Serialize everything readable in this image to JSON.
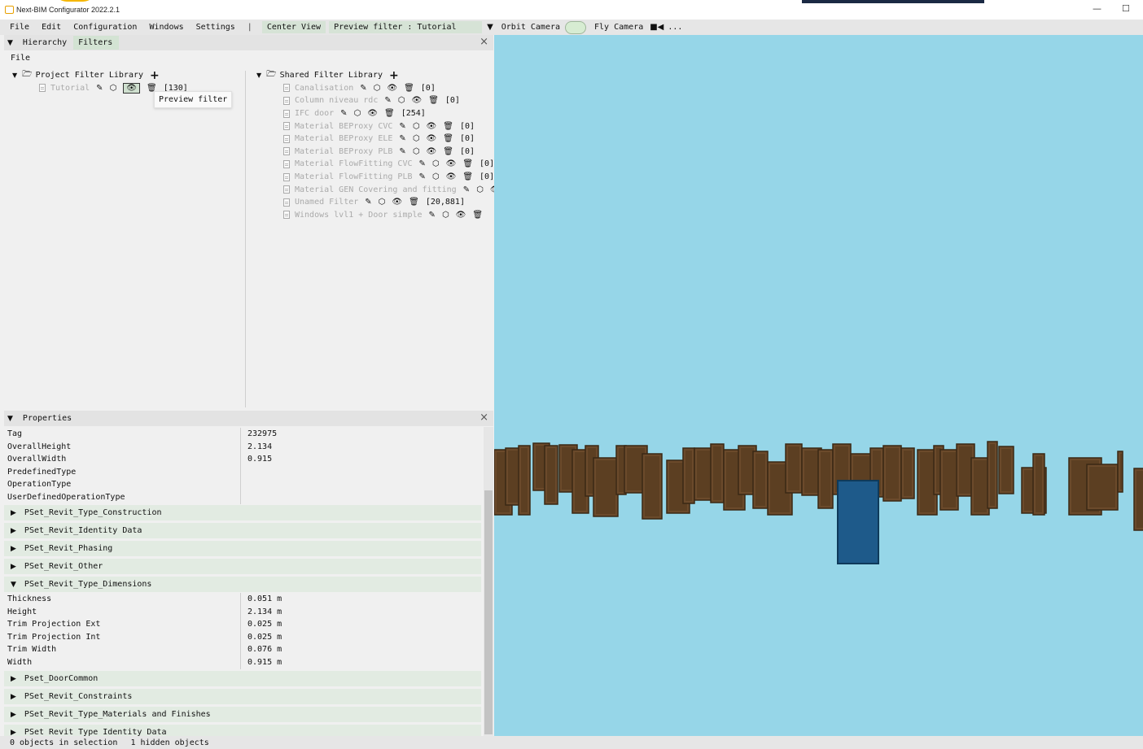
{
  "app": {
    "title": "Next-BIM Configurator 2022.2.1"
  },
  "window_controls": {
    "minimize": "—",
    "maximize": "☐"
  },
  "menubar": {
    "items": [
      "File",
      "Edit",
      "Configuration",
      "Windows",
      "Settings"
    ],
    "separator": "|",
    "center_view": "Center View",
    "preview_filter": "Preview filter : Tutorial",
    "orbit_camera": "Orbit Camera",
    "fly_camera": "Fly Camera",
    "more": "..."
  },
  "left_panel": {
    "tabs": [
      "Hierarchy",
      "Filters"
    ],
    "active_tab": "Filters",
    "file_label": "File",
    "project_library": {
      "title": "Project Filter Library",
      "filters": [
        {
          "name": "Tutorial",
          "count": "[130]"
        }
      ]
    },
    "shared_library": {
      "title": "Shared Filter Library",
      "filters": [
        {
          "name": "Canalisation",
          "count": "[0]"
        },
        {
          "name": "Column niveau rdc",
          "count": "[0]"
        },
        {
          "name": "IFC door",
          "count": "[254]"
        },
        {
          "name": "Material BEProxy CVC",
          "count": "[0]"
        },
        {
          "name": "Material BEProxy ELE",
          "count": "[0]"
        },
        {
          "name": "Material BEProxy PLB",
          "count": "[0]"
        },
        {
          "name": "Material FlowFitting CVC",
          "count": "[0]"
        },
        {
          "name": "Material FlowFitting PLB",
          "count": "[0]"
        },
        {
          "name": "Material GEN Covering and fitting",
          "count": ""
        },
        {
          "name": "Unamed Filter",
          "count": "[20,881]"
        },
        {
          "name": "Windows lvl1 + Door simple",
          "count": ""
        }
      ]
    },
    "tooltip": "Preview filter"
  },
  "properties": {
    "title": "Properties",
    "rows": [
      {
        "key": "Tag",
        "value": "232975"
      },
      {
        "key": "OverallHeight",
        "value": "2.134"
      },
      {
        "key": "OverallWidth",
        "value": "0.915"
      },
      {
        "key": "PredefinedType",
        "value": ""
      },
      {
        "key": "OperationType",
        "value": ""
      },
      {
        "key": "UserDefinedOperationType",
        "value": ""
      }
    ],
    "psets_top": [
      "PSet_Revit_Type_Construction",
      "PSet_Revit_Identity Data",
      "PSet_Revit_Phasing",
      "PSet_Revit_Other"
    ],
    "expanded_pset": "PSet_Revit_Type_Dimensions",
    "dimensions": [
      {
        "key": "Thickness",
        "value": "0.051 m"
      },
      {
        "key": "Height",
        "value": "2.134 m"
      },
      {
        "key": "Trim Projection Ext",
        "value": "0.025 m"
      },
      {
        "key": "Trim Projection Int",
        "value": "0.025 m"
      },
      {
        "key": "Trim Width",
        "value": "0.076 m"
      },
      {
        "key": "Width",
        "value": "0.915 m"
      }
    ],
    "psets_bottom": [
      "Pset_DoorCommon",
      "PSet_Revit_Constraints",
      "PSet_Revit_Type_Materials and Finishes",
      "PSet_Revit_Type_Identity Data"
    ]
  },
  "status": {
    "selection": "0 objects in selection",
    "hidden": "1 hidden objects"
  },
  "colors": {
    "viewport_bg": "#96d6e8",
    "door": "#6b4a2b",
    "selected_door": "#1e5a8a",
    "accent_tab": "#d3e3d3"
  }
}
